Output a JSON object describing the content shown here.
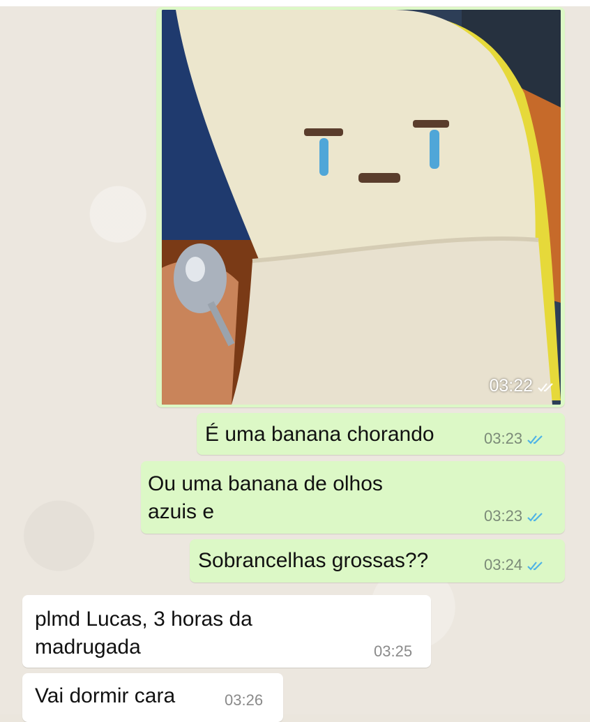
{
  "chat": {
    "photo_message": {
      "time": "03:22",
      "status": "read"
    },
    "messages": [
      {
        "direction": "outgoing",
        "lines": [
          "É uma banana chorando"
        ],
        "time": "03:23",
        "status": "read"
      },
      {
        "direction": "outgoing",
        "lines": [
          "Ou uma banana de olhos",
          "azuis e"
        ],
        "time": "03:23",
        "status": "read"
      },
      {
        "direction": "outgoing",
        "lines": [
          "Sobrancelhas grossas??"
        ],
        "time": "03:24",
        "status": "read"
      },
      {
        "direction": "incoming",
        "lines": [
          "plmd Lucas, 3 horas da",
          "madrugada"
        ],
        "time": "03:25"
      },
      {
        "direction": "incoming",
        "lines": [
          "Vai dormir cara"
        ],
        "time": "03:26"
      }
    ]
  },
  "colors": {
    "outgoing_bubble": "#dcf8c6",
    "incoming_bubble": "#ffffff",
    "read_tick": "#4fb3e6",
    "background": "#ece7df"
  },
  "icons": {
    "read_receipt": "double-check-icon"
  }
}
